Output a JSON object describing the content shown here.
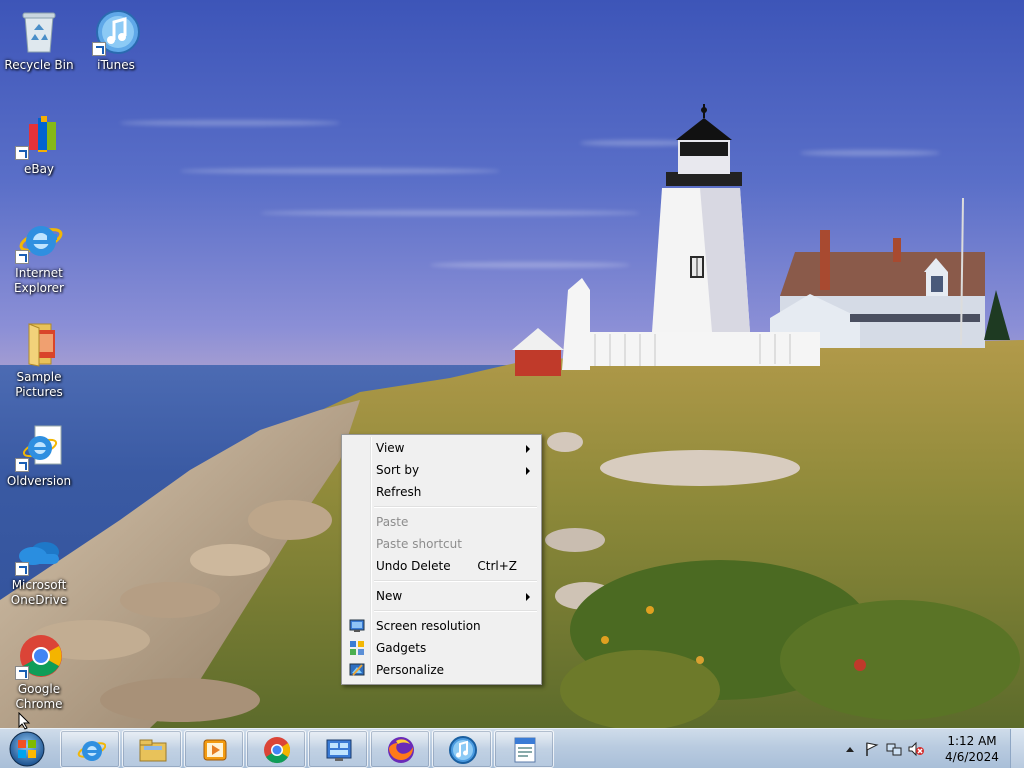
{
  "desktop_icons": [
    {
      "label": "Recycle Bin"
    },
    {
      "label": "iTunes"
    },
    {
      "label": "eBay"
    },
    {
      "label": "Internet Explorer"
    },
    {
      "label": "Sample Pictures"
    },
    {
      "label": "Oldversion"
    },
    {
      "label": "Microsoft OneDrive"
    },
    {
      "label": "Google Chrome"
    }
  ],
  "context_menu": {
    "view": "View",
    "sort_by": "Sort by",
    "refresh": "Refresh",
    "paste": "Paste",
    "paste_shortcut": "Paste shortcut",
    "undo_delete": "Undo Delete",
    "undo_delete_accel": "Ctrl+Z",
    "new": "New",
    "screen_resolution": "Screen resolution",
    "gadgets": "Gadgets",
    "personalize": "Personalize"
  },
  "taskbar": {
    "pinned": [
      "ie-icon",
      "file-explorer-icon",
      "media-player-icon",
      "chrome-icon",
      "control-panel-icon",
      "firefox-icon",
      "itunes-icon",
      "wordpad-icon"
    ],
    "clock_time": "1:12 AM",
    "clock_date": "4/6/2024"
  },
  "colors": {
    "taskbar_top": "#cfdcea",
    "menu_bg": "#f0f0f0",
    "menu_disabled": "#8d8d8d"
  }
}
